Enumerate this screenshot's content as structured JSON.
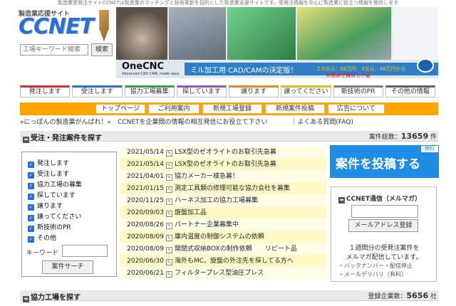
{
  "header": {
    "tagline": "製造業受発注サイトCCNETは製造業のマッチングと技術革新を目的とした製造業支援サイトです。受発注情報を中心に製造業に役立つ情報を発信します",
    "logo_sub": "製造業応援サイト",
    "logo_main": "CCNET",
    "search_placeholder": "工場キーワード検索",
    "search_button": "検索"
  },
  "banner": {
    "brand": "OneCNC",
    "brand_sub": "Advanced CAD CAM, made easy",
    "headline": "ミル加工用 CAD/CAMの決定版！",
    "price": "2.5次元：28万円　3次元：48万円から",
    "free_note": "年間保守費用も不要"
  },
  "nav": {
    "tabs": [
      {
        "label": "発注します",
        "color": "#d03030"
      },
      {
        "label": "受注します",
        "color": "#2f6fd0"
      },
      {
        "label": "協力工場募集",
        "color": "#3aa040"
      },
      {
        "label": "探しています",
        "color": "#8a5ab8"
      },
      {
        "label": "譲ります",
        "color": "#e08a20"
      },
      {
        "label": "譲ってください",
        "color": "#d8c020"
      },
      {
        "label": "新技術のPR",
        "color": "#808080"
      },
      {
        "label": "その他の情報",
        "color": "#606060"
      }
    ]
  },
  "subnav": {
    "tabs": [
      "トップページ",
      "ご利用案内",
      "新規工場登録",
      "新規案件投稿",
      "広告について"
    ]
  },
  "ticker": {
    "message": "»にっぽんの製造業がんばれ！«　CCNETを企業間の情報の相互発信にお役立て下さい",
    "faq": "｜よくある質問(FAQ)"
  },
  "section_cases": {
    "title": "受注・発注案件を探す",
    "count_label": "案件総数：",
    "count_value": "13659",
    "count_unit": "件"
  },
  "filters": {
    "items": [
      "発注します",
      "受注します",
      "協力工場の募集",
      "探しています",
      "譲ります",
      "譲ってください",
      "新技術のPR",
      "その他"
    ],
    "keyword_label": "キーワード",
    "search_button": "案件サーチ"
  },
  "listings": [
    {
      "date": "2021/05/14",
      "title": "LSX型のゼオライトのお取引先急募"
    },
    {
      "date": "2021/05/14",
      "title": "LSX型のゼオライトのお取引先急募"
    },
    {
      "date": "2021/04/01",
      "title": "協力メーカー様急募！"
    },
    {
      "date": "2021/01/15",
      "title": "測定工具類の修理可能な協力会社を募集"
    },
    {
      "date": "2020/11/25",
      "title": "ハーネス加工の協力工場募集"
    },
    {
      "date": "2020/09/03",
      "title": "旋盤加工品"
    },
    {
      "date": "2020/08/26",
      "title": "パートナー企業募集中"
    },
    {
      "date": "2020/08/09",
      "title": "庫内温度の制御システムの依頼"
    },
    {
      "date": "2020/08/09",
      "title": "開閉式収納BOXの制作依頼　　リピート品"
    },
    {
      "date": "2020/06/30",
      "title": "海外もMC、旋盤の外注先を探してる方へ"
    },
    {
      "date": "2020/06/21",
      "title": "フィルタープレス型油圧プレス"
    }
  ],
  "post": {
    "label": "案件を投稿する",
    "badge": "無料"
  },
  "mailmag": {
    "title": "CCNET通信（メルマガ）",
    "button": "メールアドレス登録",
    "desc1": "１週間分の受発注案件を",
    "desc2": "メルマガ配信しています。",
    "link1": "・バックナンバー・配信停止",
    "link2": "・メールデリバリ（有料）"
  },
  "section_factories": {
    "title": "協力工場を探す",
    "count_label": "登録企業数：",
    "count_value": "5656",
    "count_unit": "社"
  }
}
